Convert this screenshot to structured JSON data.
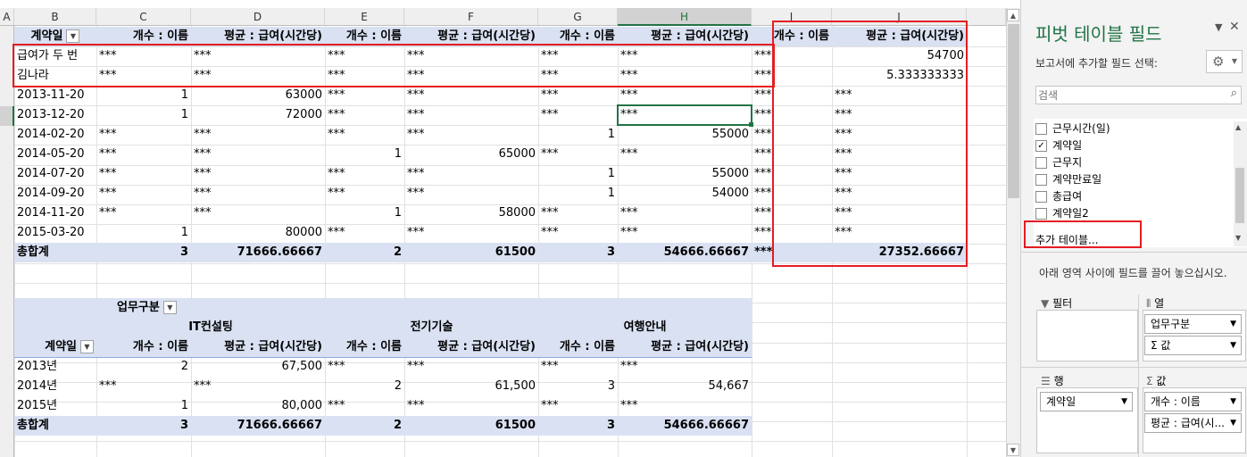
{
  "columns": [
    "A",
    "B",
    "C",
    "D",
    "E",
    "F",
    "G",
    "H",
    "I",
    "J"
  ],
  "pivot1": {
    "headers": [
      "계약일",
      "개수 : 이름",
      "평균 : 급여(시간당)",
      "개수 : 이름",
      "평균 : 급여(시간당)",
      "개수 : 이름",
      "평균 : 급여(시간당)",
      "개수 : 이름",
      "평균 : 급여(시간당)"
    ],
    "rows": [
      [
        "급여가 두 번",
        "***",
        "***",
        "***",
        "***",
        "***",
        "***",
        "***",
        "54700"
      ],
      [
        "김나라",
        "***",
        "***",
        "***",
        "***",
        "***",
        "***",
        "***",
        "5.333333333"
      ],
      [
        "2013-11-20",
        "1",
        "63000",
        "***",
        "***",
        "***",
        "***",
        "***",
        "***"
      ],
      [
        "2013-12-20",
        "1",
        "72000",
        "***",
        "***",
        "***",
        "***",
        "***",
        "***"
      ],
      [
        "2014-02-20",
        "***",
        "***",
        "***",
        "***",
        "1",
        "55000",
        "***",
        "***"
      ],
      [
        "2014-05-20",
        "***",
        "***",
        "1",
        "65000",
        "***",
        "***",
        "***",
        "***"
      ],
      [
        "2014-07-20",
        "***",
        "***",
        "***",
        "***",
        "1",
        "55000",
        "***",
        "***"
      ],
      [
        "2014-09-20",
        "***",
        "***",
        "***",
        "***",
        "1",
        "54000",
        "***",
        "***"
      ],
      [
        "2014-11-20",
        "***",
        "***",
        "1",
        "58000",
        "***",
        "***",
        "***",
        "***"
      ],
      [
        "2015-03-20",
        "1",
        "80000",
        "***",
        "***",
        "***",
        "***",
        "***",
        "***"
      ]
    ],
    "total": [
      "총합계",
      "3",
      "71666.66667",
      "2",
      "61500",
      "3",
      "54666.66667",
      "***",
      "27352.66667"
    ]
  },
  "pivot2": {
    "col_field": "업무구분",
    "groups": [
      "IT컨설팅",
      "전기기술",
      "여행안내"
    ],
    "headers": [
      "계약일",
      "개수 : 이름",
      "평균 : 급여(시간당)",
      "개수 : 이름",
      "평균 : 급여(시간당)",
      "개수 : 이름",
      "평균 : 급여(시간당)"
    ],
    "rows": [
      [
        "2013년",
        "2",
        "67,500",
        "***",
        "***",
        "***",
        "***"
      ],
      [
        "2014년",
        "***",
        "***",
        "2",
        "61,500",
        "3",
        "54,667"
      ],
      [
        "2015년",
        "1",
        "80,000",
        "***",
        "***",
        "***",
        "***"
      ]
    ],
    "total": [
      "총합계",
      "3",
      "71666.66667",
      "2",
      "61500",
      "3",
      "54666.66667"
    ]
  },
  "pane": {
    "title": "피벗 테이블 필드",
    "subtitle": "보고서에 추가할 필드 선택:",
    "search_placeholder": "검색",
    "fields": [
      {
        "label": "근무시간(일)",
        "checked": false
      },
      {
        "label": "계약일",
        "checked": true
      },
      {
        "label": "근무지",
        "checked": false
      },
      {
        "label": "계약만료일",
        "checked": false
      },
      {
        "label": "총급여",
        "checked": false
      },
      {
        "label": "계약일2",
        "checked": false
      }
    ],
    "more_tables": "추가 테이블...",
    "drag_hint": "아래 영역 사이에 필드를 끌어 놓으십시오.",
    "filter_label": "필터",
    "columns_label": "열",
    "rows_label": "행",
    "values_label": "값",
    "columns_items": [
      "업무구분",
      "Σ 값"
    ],
    "rows_items": [
      "계약일"
    ],
    "values_items": [
      "개수 : 이름",
      "평균 : 급여(시..."
    ],
    "checkmark": "✓",
    "close": "✕",
    "gear": "⚙"
  },
  "colors": {
    "band": "#d9e1f2",
    "accent": "#217346",
    "highlight": "#e51c23"
  }
}
